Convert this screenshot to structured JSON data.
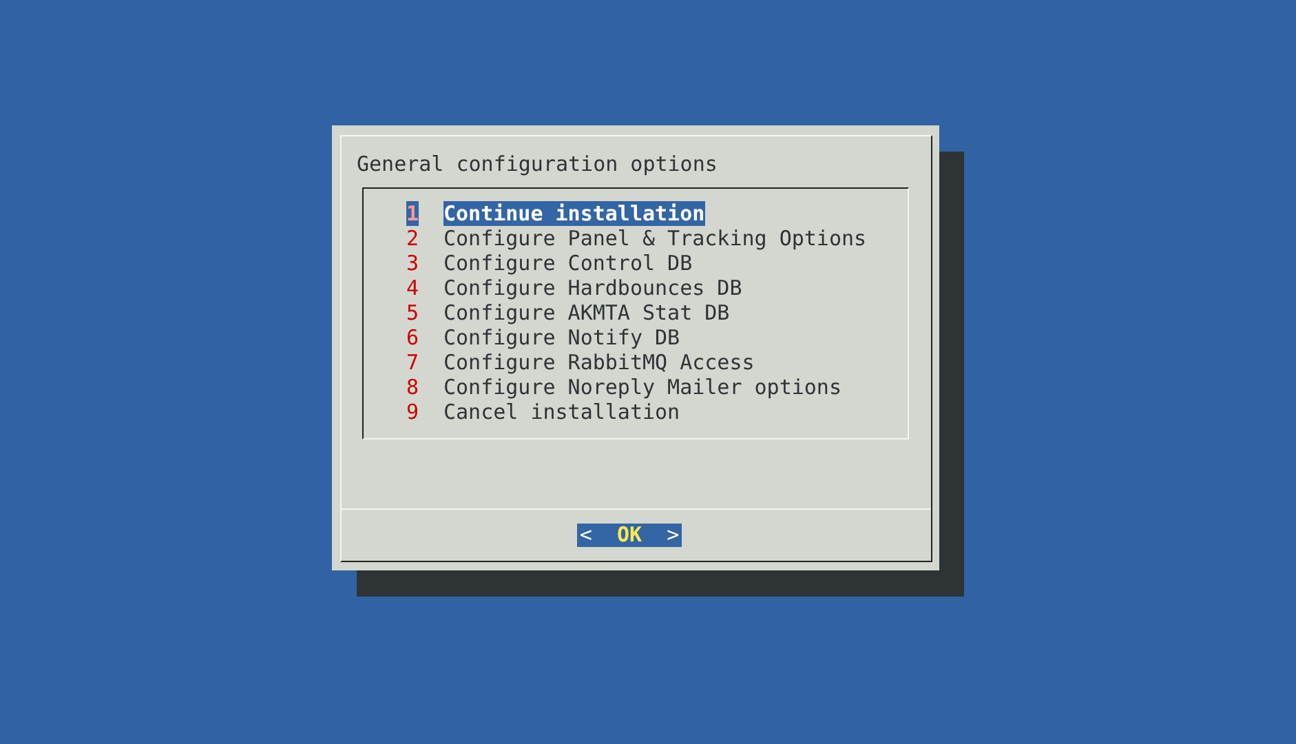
{
  "dialog": {
    "title": "General configuration options",
    "items": [
      {
        "number": "1",
        "label": "Continue installation",
        "selected": true
      },
      {
        "number": "2",
        "label": "Configure Panel & Tracking Options",
        "selected": false
      },
      {
        "number": "3",
        "label": "Configure Control DB",
        "selected": false
      },
      {
        "number": "4",
        "label": "Configure Hardbounces DB",
        "selected": false
      },
      {
        "number": "5",
        "label": "Configure AKMTA Stat DB",
        "selected": false
      },
      {
        "number": "6",
        "label": "Configure Notify DB",
        "selected": false
      },
      {
        "number": "7",
        "label": "Configure RabbitMQ Access",
        "selected": false
      },
      {
        "number": "8",
        "label": "Configure Noreply Mailer options",
        "selected": false
      },
      {
        "number": "9",
        "label": "Cancel installation",
        "selected": false
      }
    ],
    "button": {
      "left": "<",
      "label": "OK",
      "right": ">",
      "selected": true
    }
  }
}
